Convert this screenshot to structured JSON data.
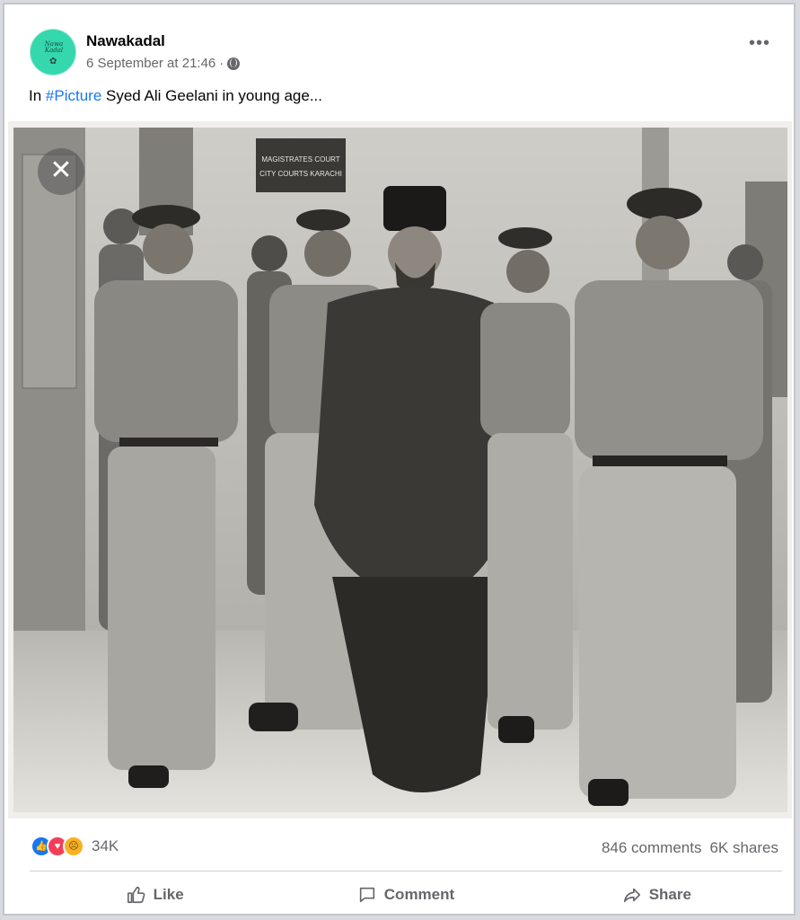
{
  "post": {
    "page_name": "Nawakadal",
    "timestamp": "6 September at 21:46",
    "separator": "·",
    "avatar_text": "Nawa Kadal",
    "more_label": "•••",
    "caption_prefix": "In ",
    "caption_hashtag": "#Picture",
    "caption_rest": " Syed Ali Geelani in young age...",
    "photo_sign_line1": "MAGISTRATES COURT",
    "photo_sign_line2": "CITY COURTS KARACHI",
    "close_label": "✕"
  },
  "engagement": {
    "reaction_count": "34K",
    "comments": "846 comments",
    "shares": "6K shares"
  },
  "actions": {
    "like": "Like",
    "comment": "Comment",
    "share": "Share"
  },
  "colors": {
    "accent": "#1877f2",
    "avatar_bg": "#35d7ad",
    "secondary_text": "#65676b"
  }
}
